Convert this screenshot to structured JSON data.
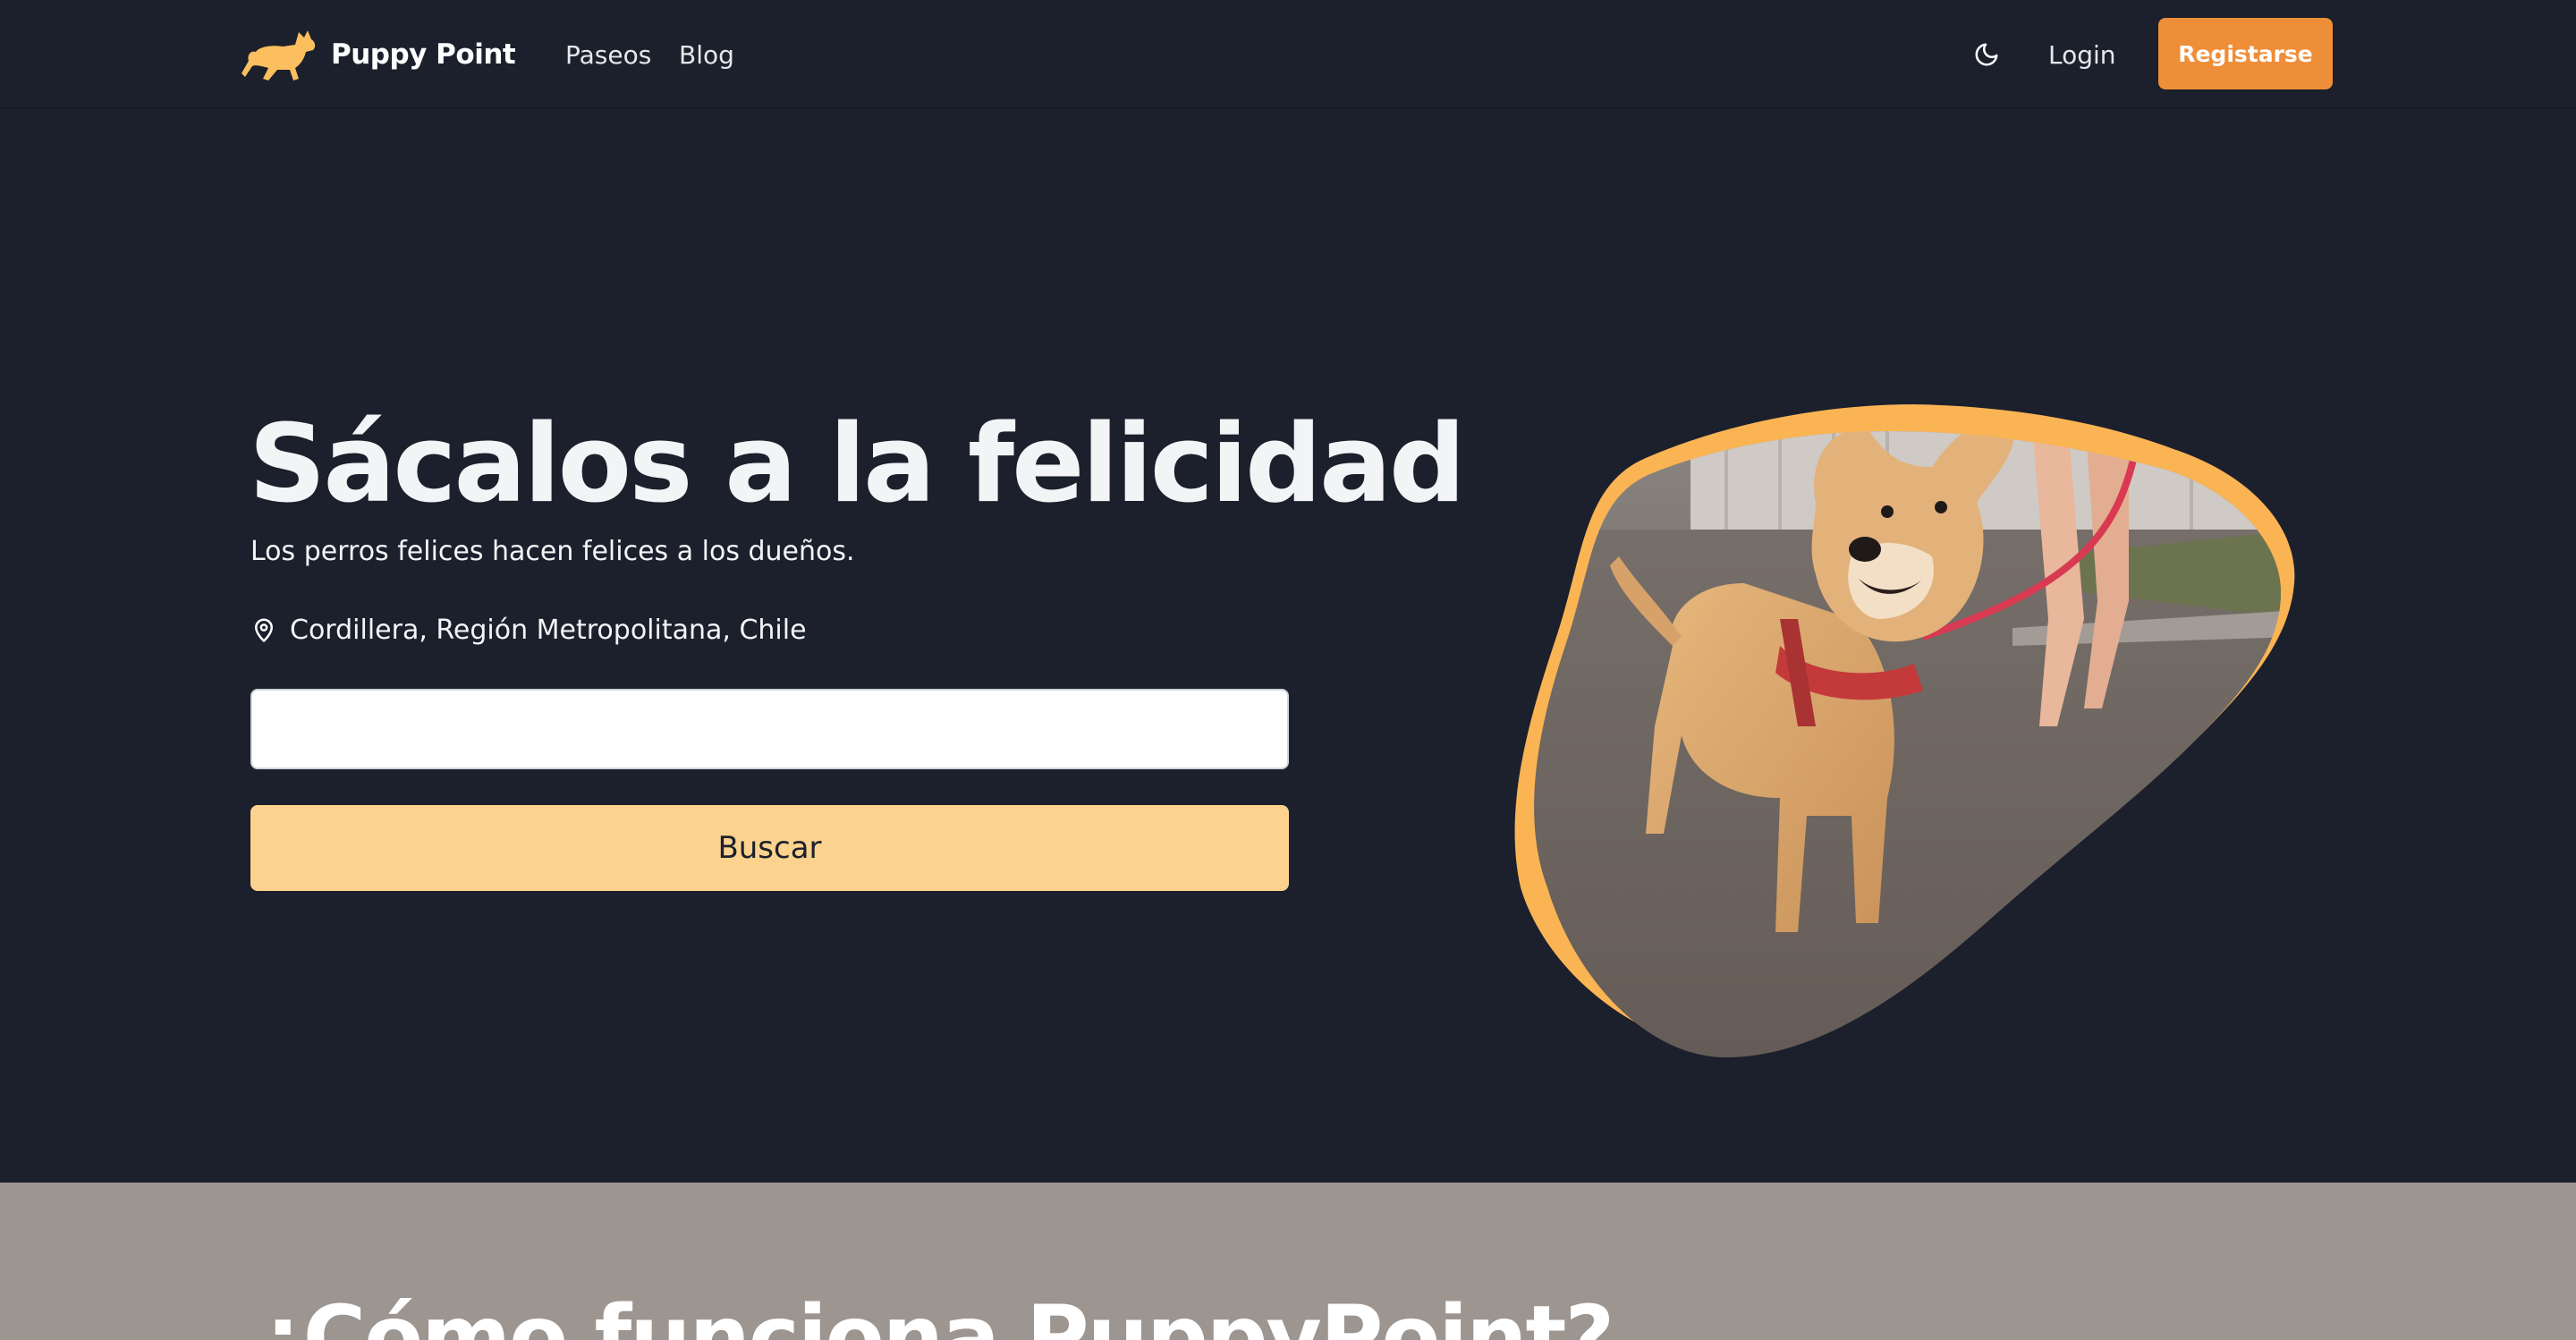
{
  "brand": {
    "name": "Puppy Point",
    "logo_icon": "dog-running-icon"
  },
  "nav": {
    "links": [
      {
        "label": "Paseos"
      },
      {
        "label": "Blog"
      }
    ],
    "theme_icon": "moon-icon",
    "login_label": "Login",
    "register_label": "Registarse"
  },
  "hero": {
    "title": "Sácalos a la felicidad",
    "subtitle": "Los perros felices hacen felices a los dueños.",
    "location_icon": "map-pin-icon",
    "location": "Cordillera, Región Metropolitana, Chile",
    "search_value": "",
    "search_button": "Buscar",
    "image_alt": "dog-on-leash-photo"
  },
  "how_it_works": {
    "title": "¿Cómo funciona PuppyPoint?"
  },
  "colors": {
    "background": "#1b202c",
    "accent": "#ef8e38",
    "button_light": "#fcd28e",
    "blob": "#fbb454",
    "section_gray": "#9d9590"
  }
}
